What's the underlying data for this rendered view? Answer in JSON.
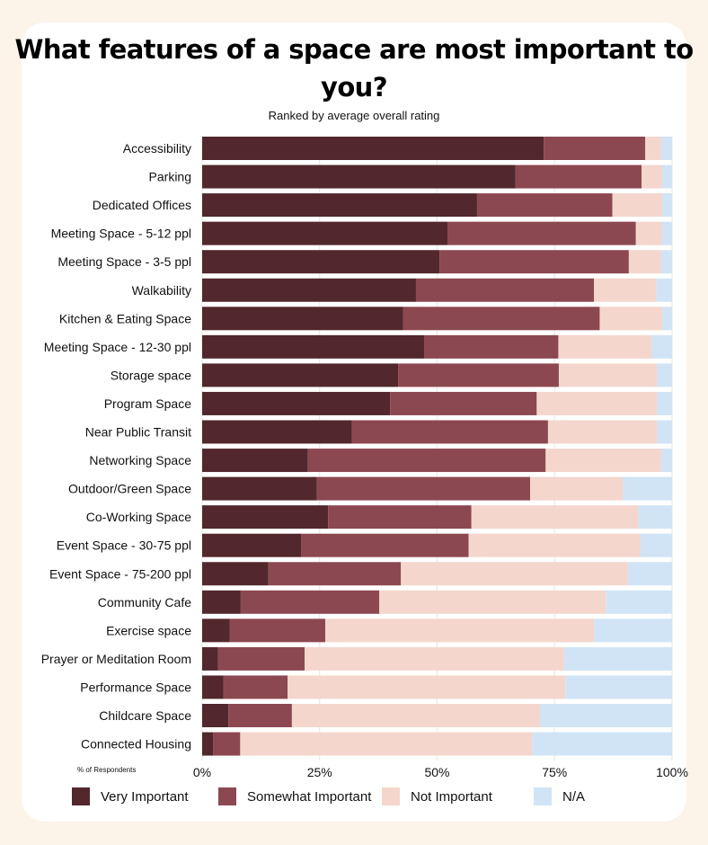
{
  "chart_data": {
    "type": "bar",
    "orientation": "horizontal",
    "stacked": true,
    "title": "What features of a space are most important to you?",
    "subtitle": "Ranked by average overall rating",
    "xlabel": "% of Respondents",
    "ylabel": "",
    "xlim": [
      0,
      100
    ],
    "xticks": [
      "0%",
      "25%",
      "50%",
      "75%",
      "100%"
    ],
    "grid": true,
    "legend_position": "bottom",
    "categories": [
      "Accessibility",
      "Parking",
      "Dedicated Offices",
      "Meeting Space - 5-12 ppl",
      "Meeting Space - 3-5 ppl",
      "Walkability",
      "Kitchen & Eating Space",
      "Meeting Space - 12-30 ppl",
      "Storage space",
      "Program Space",
      "Near Public Transit",
      "Networking Space",
      "Outdoor/Green Space",
      "Co-Working Space",
      "Event Space - 30-75 ppl",
      "Event Space - 75-200 ppl",
      "Community Cafe",
      "Exercise space",
      "Prayer or Meditation Room",
      "Performance Space",
      "Childcare Space",
      "Connected Housing"
    ],
    "series": [
      {
        "name": "Very Important",
        "color": "#52272d",
        "values": [
          72.7,
          66.7,
          58.5,
          52.2,
          50.5,
          45.5,
          42.8,
          47.3,
          41.7,
          40.0,
          31.9,
          22.5,
          24.4,
          26.8,
          21.1,
          14.1,
          8.2,
          5.9,
          3.4,
          4.5,
          5.6,
          2.3
        ]
      },
      {
        "name": "Somewhat Important",
        "color": "#8c4850",
        "values": [
          21.6,
          26.8,
          28.8,
          40.1,
          40.3,
          37.9,
          41.8,
          28.5,
          34.2,
          31.2,
          41.7,
          50.6,
          45.4,
          30.5,
          35.6,
          28.2,
          29.5,
          20.3,
          18.4,
          13.7,
          13.5,
          5.8
        ]
      },
      {
        "name": "Not Important",
        "color": "#f4d6cc",
        "values": [
          3.4,
          4.4,
          10.6,
          5.5,
          6.9,
          13.3,
          13.3,
          19.8,
          20.9,
          25.6,
          23.2,
          24.6,
          19.7,
          35.5,
          36.6,
          48.3,
          48.2,
          57.2,
          55.2,
          59.1,
          52.8,
          62.1
        ]
      },
      {
        "name": "N/A",
        "color": "#d0e4f6",
        "values": [
          2.3,
          2.1,
          2.1,
          2.2,
          2.3,
          3.3,
          2.1,
          4.4,
          3.2,
          3.2,
          3.2,
          2.3,
          10.5,
          7.2,
          6.7,
          9.4,
          14.1,
          16.6,
          23.0,
          22.7,
          28.1,
          29.8
        ]
      }
    ]
  }
}
